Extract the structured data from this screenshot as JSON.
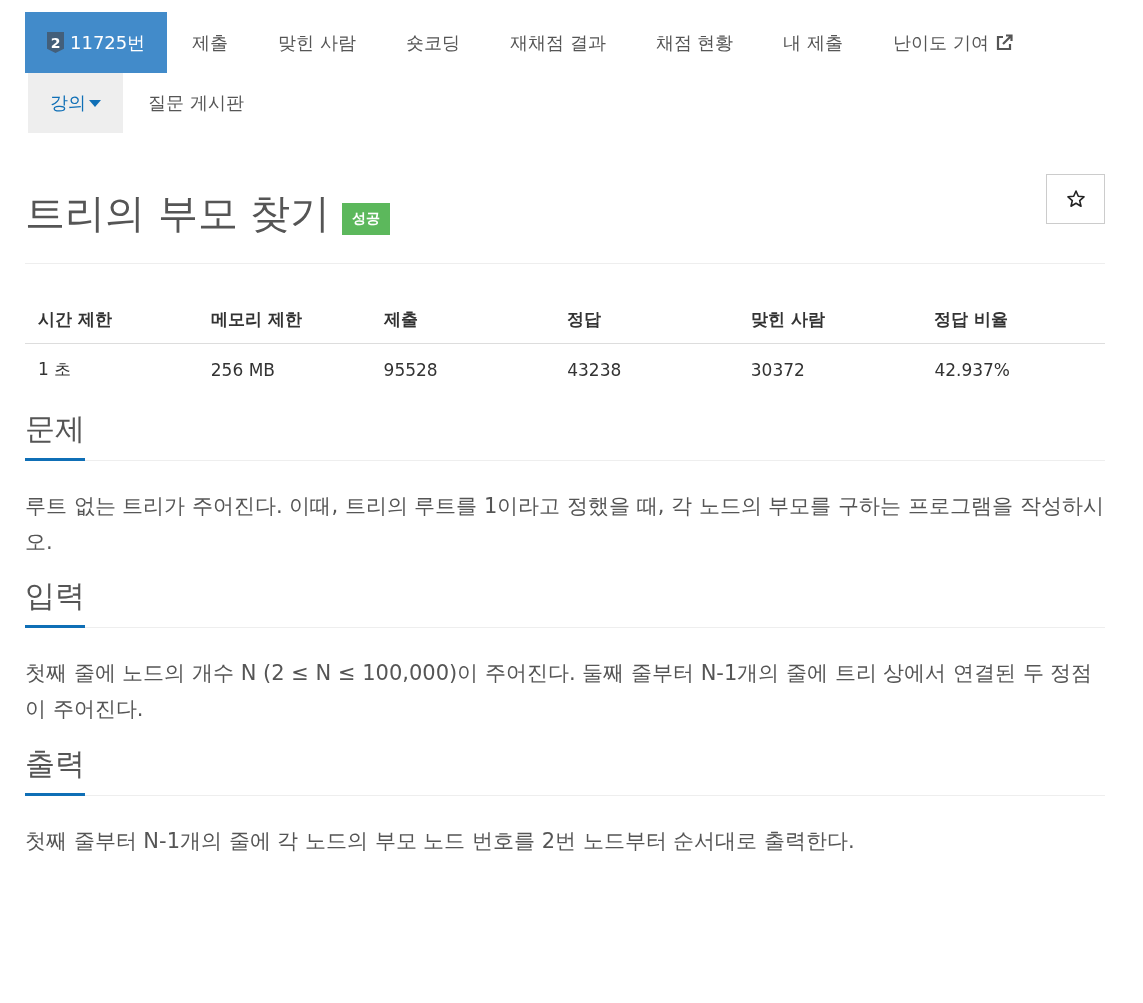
{
  "nav_rows": [
    [
      {
        "kind": "problem",
        "badge": "2",
        "label": "11725번",
        "selected": true,
        "highlighted": false
      },
      {
        "kind": "link",
        "label": "제출",
        "selected": false,
        "highlighted": false
      },
      {
        "kind": "link",
        "label": "맞힌 사람",
        "selected": false,
        "highlighted": false
      },
      {
        "kind": "link",
        "label": "숏코딩",
        "selected": false,
        "highlighted": false
      },
      {
        "kind": "link",
        "label": "재채점 결과",
        "selected": false,
        "highlighted": false
      },
      {
        "kind": "link",
        "label": "채점 현황",
        "selected": false,
        "highlighted": false
      },
      {
        "kind": "link",
        "label": "내 제출",
        "selected": false,
        "highlighted": false
      },
      {
        "kind": "external",
        "label": "난이도 기여",
        "selected": false,
        "highlighted": false
      }
    ],
    [
      {
        "kind": "dropdown",
        "label": "강의",
        "selected": false,
        "highlighted": true
      },
      {
        "kind": "link",
        "label": "질문 게시판",
        "selected": false,
        "highlighted": false
      }
    ]
  ],
  "title": "트리의 부모 찾기",
  "status_badge": "성공",
  "table": {
    "columns": [
      "시간 제한",
      "메모리 제한",
      "제출",
      "정답",
      "맞힌 사람",
      "정답 비율"
    ],
    "rows": [
      [
        "1 초",
        "256 MB",
        "95528",
        "43238",
        "30372",
        "42.937%"
      ]
    ]
  },
  "sections": [
    {
      "heading": "문제",
      "text": "루트 없는 트리가 주어진다. 이때, 트리의 루트를 1이라고 정했을 때, 각 노드의 부모를 구하는 프로그램을 작성하시오."
    },
    {
      "heading": "입력",
      "text": "첫째 줄에 노드의 개수 N (2 ≤ N ≤ 100,000)이 주어진다. 둘째 줄부터 N-1개의 줄에 트리 상에서 연결된 두 정점이 주어진다."
    },
    {
      "heading": "출력",
      "text": "첫째 줄부터 N-1개의 줄에 각 노드의 부모 노드 번호를 2번 노드부터 순서대로 출력한다."
    }
  ]
}
